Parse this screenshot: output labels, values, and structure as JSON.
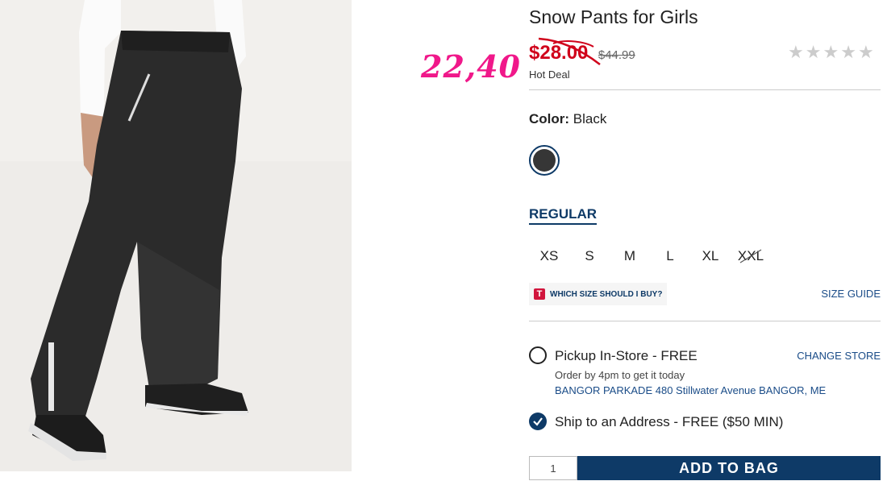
{
  "product": {
    "title": "Snow Pants for Girls",
    "sale_price": "$28.00",
    "original_price": "$44.99",
    "deal_label": "Hot Deal",
    "handwritten_price": "22,40",
    "rating_stars": 0,
    "image_icon": "product-photo-snow-pants"
  },
  "color": {
    "label": "Color:",
    "value": "Black",
    "swatch_hex": "#363636"
  },
  "fit": {
    "label": "REGULAR"
  },
  "sizes": [
    "XS",
    "S",
    "M",
    "L",
    "XL",
    "XXL"
  ],
  "size_help": {
    "badge_letter": "T",
    "text": "WHICH SIZE SHOULD I BUY?",
    "guide": "SIZE GUIDE"
  },
  "fulfillment": {
    "pickup_label": "Pickup In-Store - FREE",
    "change_store": "CHANGE STORE",
    "order_by": "Order by 4pm to get it today",
    "store_address": "BANGOR PARKADE 480 Stillwater Avenue  BANGOR, ME",
    "ship_label": "Ship to an Address - FREE ($50 MIN)"
  },
  "cart": {
    "qty": "1",
    "add_to_bag": "ADD TO BAG"
  },
  "colors": {
    "sale_red": "#d0021b",
    "navy": "#0e3a67",
    "link_blue": "#1a4c88",
    "annotation_pink": "#f0188a"
  }
}
